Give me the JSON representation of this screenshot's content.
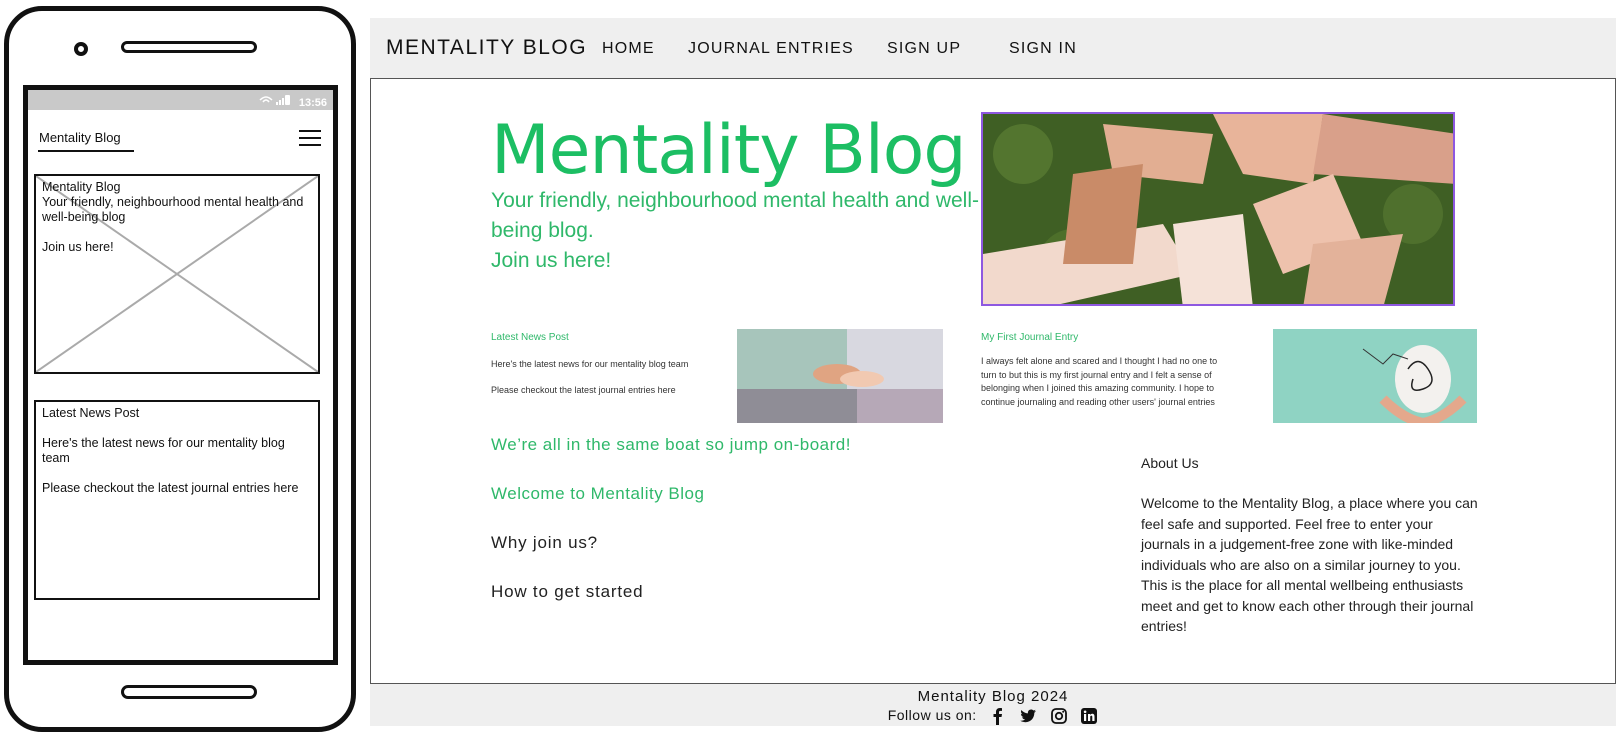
{
  "phone": {
    "status_time": "13:56",
    "title": "Mentality Blog",
    "hero_box": {
      "title": "Mentality Blog",
      "subtitle": "Your friendly, neighbourhood mental health and well-being blog",
      "cta": "Join us here!"
    },
    "news_box": {
      "title": "Latest News Post",
      "line1": "Here's the latest news for our mentality blog team",
      "line2": "Please checkout the latest journal entries here"
    }
  },
  "navbar": {
    "brand": "MENTALITY BLOG",
    "items": [
      "HOME",
      "JOURNAL ENTRIES",
      "SIGN UP",
      "SIGN IN"
    ]
  },
  "hero": {
    "title": "Mentality Blog",
    "subtitle": "Your friendly, neighbourhood mental health and well-being blog.",
    "cta": "Join us here!"
  },
  "news_card": {
    "title": "Latest News Post",
    "line1": "Here's the latest news for our mentality blog team",
    "line2": "Please checkout the latest journal entries here"
  },
  "journal_card": {
    "title": "My First Journal Entry",
    "text": "I always felt alone and scared and I thought I had no one to turn to but this is my first journal entry and I felt a sense of belonging when I joined this amazing community. I hope to continue journaling and reading other users' journal entries"
  },
  "sections": {
    "boat": "We’re all in the same boat so jump on-board!",
    "welcome": "Welcome to Mentality Blog",
    "why": "Why join us?",
    "how": "How to get started"
  },
  "about": {
    "title": "About Us",
    "text": "Welcome to the Mentality Blog, a place where you can feel safe and supported. Feel free to enter your journals in a judgement-free zone with like-minded individuals who are also on a similar journey to you. This is the place for all mental wellbeing enthusiasts meet and get to know each other through their journal entries!"
  },
  "footer": {
    "copyright": "Mentality Blog 2024",
    "follow": "Follow us on:",
    "social_icons": [
      "facebook-icon",
      "twitter-icon",
      "instagram-icon",
      "linkedin-icon"
    ]
  },
  "colors": {
    "accent_green": "#1cbe63",
    "image_border": "#8e58e0",
    "bar_grey": "#efefef"
  }
}
